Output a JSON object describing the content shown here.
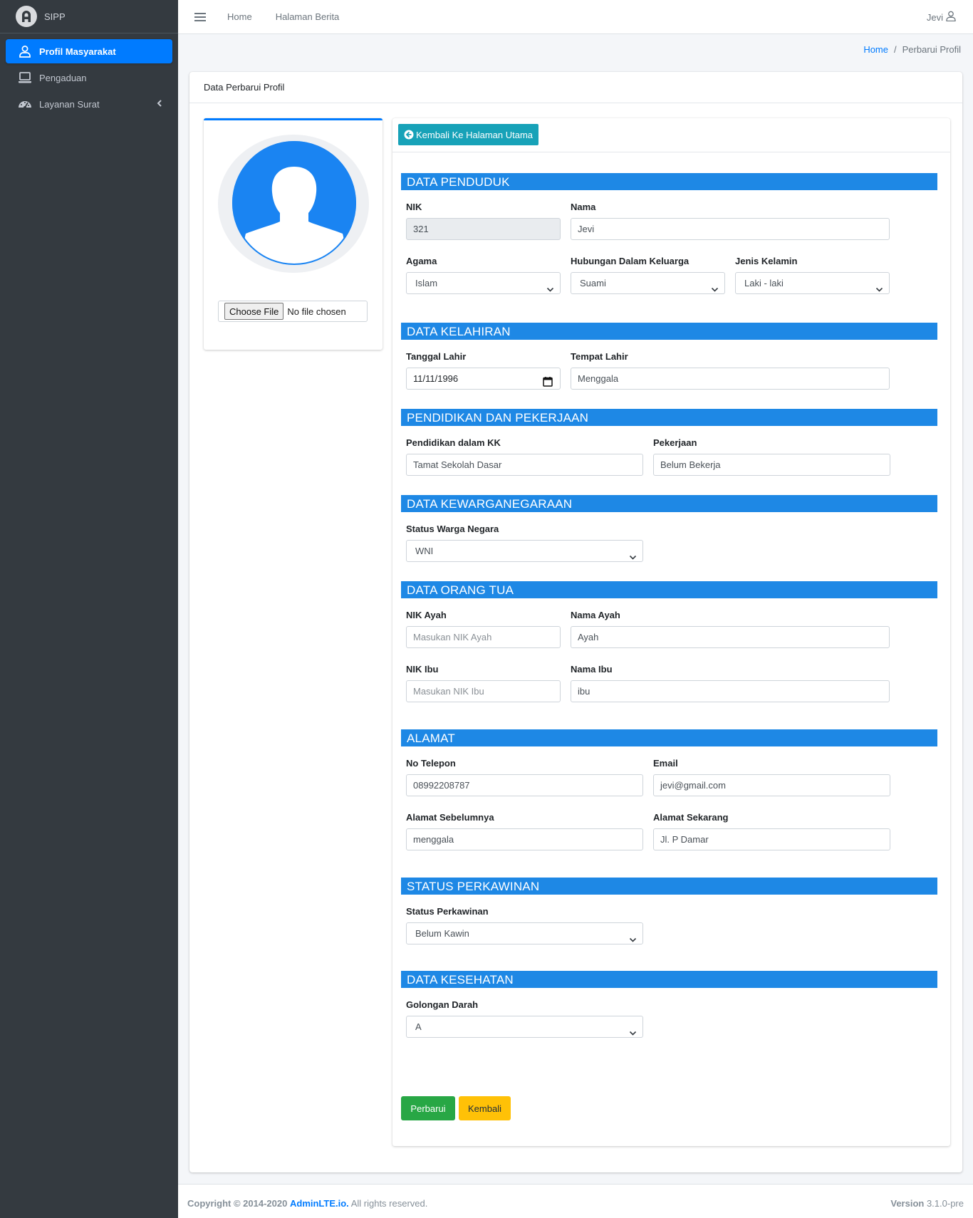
{
  "brand": {
    "name": "SIPP"
  },
  "sidebar": {
    "items": [
      {
        "label": "Profil Masyarakat",
        "icon": "user-icon"
      },
      {
        "label": "Pengaduan",
        "icon": "laptop-icon"
      },
      {
        "label": "Layanan Surat",
        "icon": "tachometer-icon"
      }
    ]
  },
  "topnav": {
    "links": [
      "Home",
      "Halaman Berita"
    ],
    "user": "Jevi"
  },
  "breadcrumb": {
    "home": "Home",
    "current": "Perbarui Profil"
  },
  "card": {
    "title": "Data Perbarui Profil"
  },
  "profile": {
    "file_button": "Choose File",
    "file_status": "No file chosen"
  },
  "actions": {
    "back": "Kembali Ke Halaman Utama",
    "submit": "Perbarui",
    "cancel": "Kembali"
  },
  "sections": {
    "penduduk": "DATA PENDUDUK",
    "kelahiran": "DATA KELAHIRAN",
    "pendidikan": "PENDIDIKAN DAN PEKERJAAN",
    "kewarganegaraan": "DATA KEWARGANEGARAAN",
    "orangtua": "DATA ORANG TUA",
    "alamat": "ALAMAT",
    "perkawinan": "STATUS PERKAWINAN",
    "kesehatan": "DATA KESEHATAN"
  },
  "fields": {
    "nik": {
      "label": "NIK",
      "value": "321"
    },
    "nama": {
      "label": "Nama",
      "value": "Jevi"
    },
    "agama": {
      "label": "Agama",
      "value": "Islam"
    },
    "hubungan": {
      "label": "Hubungan Dalam Keluarga",
      "value": "Suami"
    },
    "jenis_kelamin": {
      "label": "Jenis Kelamin",
      "value": "Laki - laki"
    },
    "tanggal_lahir": {
      "label": "Tanggal Lahir",
      "value": "11/11/1996"
    },
    "tempat_lahir": {
      "label": "Tempat Lahir",
      "value": "Menggala"
    },
    "pendidikan": {
      "label": "Pendidikan dalam KK",
      "value": "Tamat Sekolah Dasar"
    },
    "pekerjaan": {
      "label": "Pekerjaan",
      "value": "Belum Bekerja"
    },
    "status_warga": {
      "label": "Status Warga Negara",
      "value": "WNI"
    },
    "nik_ayah": {
      "label": "NIK Ayah",
      "placeholder": "Masukan NIK Ayah"
    },
    "nama_ayah": {
      "label": "Nama Ayah",
      "value": "Ayah"
    },
    "nik_ibu": {
      "label": "NIK Ibu",
      "placeholder": "Masukan NIK Ibu"
    },
    "nama_ibu": {
      "label": "Nama Ibu",
      "value": "ibu"
    },
    "telepon": {
      "label": "No Telepon",
      "value": "08992208787"
    },
    "email": {
      "label": "Email",
      "value": "jevi@gmail.com"
    },
    "alamat_sebelumnya": {
      "label": "Alamat Sebelumnya",
      "value": "menggala"
    },
    "alamat_sekarang": {
      "label": "Alamat Sekarang",
      "value": "Jl. P Damar"
    },
    "status_perkawinan": {
      "label": "Status Perkawinan",
      "value": "Belum Kawin"
    },
    "golongan_darah": {
      "label": "Golongan Darah",
      "value": "A"
    }
  },
  "footer": {
    "copyright": "Copyright © 2014-2020",
    "link": "AdminLTE.io.",
    "rights": "All rights reserved.",
    "version_label": "Version",
    "version": "3.1.0-pre"
  },
  "colors": {
    "primary": "#007bff",
    "section": "#1e88e5",
    "info": "#17a2b8",
    "success": "#28a745",
    "warning": "#ffc107",
    "sidebar": "#343a40"
  }
}
